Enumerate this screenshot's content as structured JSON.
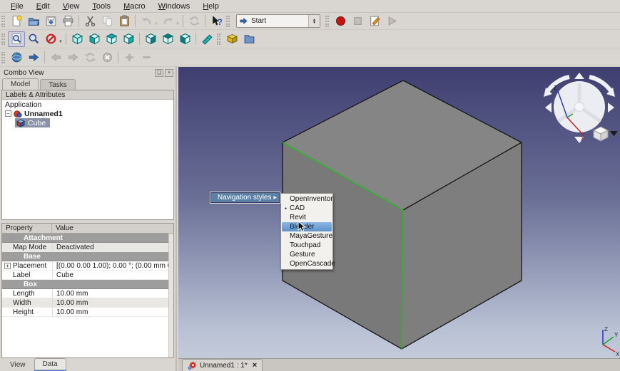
{
  "menu_bar": {
    "items": [
      {
        "label": "File"
      },
      {
        "label": "Edit"
      },
      {
        "label": "View"
      },
      {
        "label": "Tools"
      },
      {
        "label": "Macro"
      },
      {
        "label": "Windows"
      },
      {
        "label": "Help"
      }
    ]
  },
  "toolbar": {
    "workbench_selected": "Start"
  },
  "glyphs": {
    "caret": "▼",
    "spin_up": "▲",
    "spin_down": "▼",
    "close": "×",
    "float": "❏",
    "arrow_right": "▶",
    "expander_open": "−",
    "expander_plus": "+"
  },
  "combo_view": {
    "title": "Combo View",
    "tabs": [
      {
        "label": "Model",
        "active": true
      },
      {
        "label": "Tasks",
        "active": false
      }
    ],
    "tree_header": "Labels & Attributes",
    "tree": {
      "root": "Application",
      "document": "Unnamed1",
      "item": "Cube"
    }
  },
  "property_panel": {
    "columns": {
      "property": "Property",
      "value": "Value"
    },
    "rows": [
      {
        "group": true,
        "name": "Attachment"
      },
      {
        "name": "Map Mode",
        "value": "Deactivated",
        "shaded": true
      },
      {
        "group": true,
        "name": "Base"
      },
      {
        "name": "Placement",
        "value": "[(0.00 0.00 1.00); 0.00 °; (0.00 mm  0.00 ...",
        "expander": true
      },
      {
        "name": "Label",
        "value": "Cube"
      },
      {
        "group": true,
        "name": "Box"
      },
      {
        "name": "Length",
        "value": "10.00 mm"
      },
      {
        "name": "Width",
        "value": "10.00 mm",
        "shaded": true
      },
      {
        "name": "Height",
        "value": "10.00 mm"
      }
    ]
  },
  "mode_tabs": [
    {
      "label": "View"
    },
    {
      "label": "Data",
      "active": true
    }
  ],
  "mdi": {
    "tab_label": "Unnamed1 : 1*"
  },
  "context_menu": {
    "parent_label": "Navigation styles",
    "items": [
      {
        "label": "OpenInventor"
      },
      {
        "label": "CAD",
        "bullet": true
      },
      {
        "label": "Revit"
      },
      {
        "label": "Blender",
        "highlighted": true
      },
      {
        "label": "MayaGesture"
      },
      {
        "label": "Touchpad"
      },
      {
        "label": "Gesture"
      },
      {
        "label": "OpenCascade"
      }
    ]
  },
  "viewport": {
    "axis_labels": {
      "x": "X",
      "y": "Y",
      "z": "Z"
    },
    "colors": {
      "bg_top": "#3e3e70",
      "bg_bottom": "#bac2d6",
      "face": "#7e7e7e",
      "edge": "#1c1c1c",
      "selected_edge": "#2cb52c",
      "menu_highlight": "#5b80a5"
    }
  }
}
